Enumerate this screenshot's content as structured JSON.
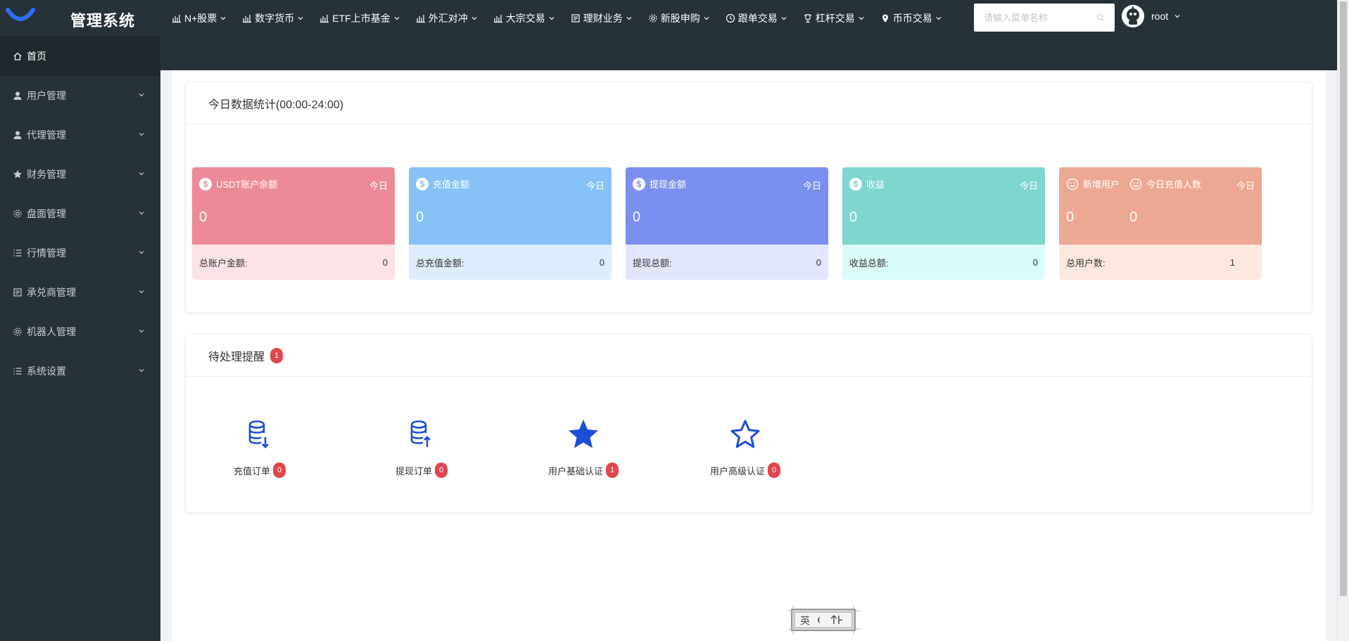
{
  "app": {
    "title": "管理系统"
  },
  "nav": [
    {
      "label": "N+股票",
      "icon": "bar-chart-icon"
    },
    {
      "label": "数字货币",
      "icon": "bar-chart-icon"
    },
    {
      "label": "ETF上市基金",
      "icon": "bar-chart-icon"
    },
    {
      "label": "外汇对冲",
      "icon": "bar-chart-icon"
    },
    {
      "label": "大宗交易",
      "icon": "bar-chart-icon"
    },
    {
      "label": "理财业务",
      "icon": "document-icon"
    },
    {
      "label": "新股申购",
      "icon": "gear-icon"
    },
    {
      "label": "跟单交易",
      "icon": "clock-icon"
    },
    {
      "label": "杠杆交易",
      "icon": "trophy-icon"
    },
    {
      "label": "币币交易",
      "icon": "location-icon"
    }
  ],
  "search": {
    "placeholder": "请输入菜单名称",
    "value": ""
  },
  "user": {
    "name": "root"
  },
  "sidebar": {
    "items": [
      {
        "label": "首页",
        "icon": "home-icon",
        "active": true
      },
      {
        "label": "用户管理",
        "icon": "user-icon"
      },
      {
        "label": "代理管理",
        "icon": "user-icon"
      },
      {
        "label": "财务管理",
        "icon": "star-icon"
      },
      {
        "label": "盘面管理",
        "icon": "gear-icon"
      },
      {
        "label": "行情管理",
        "icon": "list-icon"
      },
      {
        "label": "承兑商管理",
        "icon": "document-icon"
      },
      {
        "label": "机器人管理",
        "icon": "gear-icon"
      },
      {
        "label": "系统设置",
        "icon": "list-icon"
      }
    ]
  },
  "stats": {
    "title": "今日数据统计(00:00-24:00)",
    "cards": [
      {
        "title": "USDT账户余额",
        "tag": "今日",
        "value": "0",
        "footer_label": "总账户金额:",
        "footer_value": "0",
        "top_color": "#ec8b97",
        "bottom_color": "#fde3e7"
      },
      {
        "title": "充值金额",
        "tag": "今日",
        "value": "0",
        "footer_label": "总充值金额:",
        "footer_value": "0",
        "top_color": "#86c1f7",
        "bottom_color": "#deedfd"
      },
      {
        "title": "提现金额",
        "tag": "今日",
        "value": "0",
        "footer_label": "提现总额:",
        "footer_value": "0",
        "top_color": "#7b8ff1",
        "bottom_color": "#e2e6fc"
      },
      {
        "title": "收益",
        "tag": "今日",
        "value": "0",
        "footer_label": "收益总额:",
        "footer_value": "0",
        "top_color": "#7fd6cf",
        "bottom_color": "#d9fcf8"
      },
      {
        "title": "新增用户",
        "title2": "今日充值人数",
        "tag": "今日",
        "value": "0",
        "value2": "0",
        "footer_label": "总用户数:",
        "footer_value": "1",
        "top_color": "#eca893",
        "bottom_color": "#fde8e0"
      }
    ]
  },
  "todos": {
    "title": "待处理提醒",
    "count": "1",
    "items": [
      {
        "label": "充值订单",
        "count": "0",
        "icon": "database-download-icon"
      },
      {
        "label": "提现订单",
        "count": "0",
        "icon": "database-upload-icon"
      },
      {
        "label": "用户基础认证",
        "count": "1",
        "icon": "star-filled-icon"
      },
      {
        "label": "用户高级认证",
        "count": "0",
        "icon": "star-outline-icon"
      }
    ]
  },
  "colors": {
    "sidebar_bg": "#263238",
    "accent": "#1d4ed8",
    "badge": "#e0474c"
  }
}
